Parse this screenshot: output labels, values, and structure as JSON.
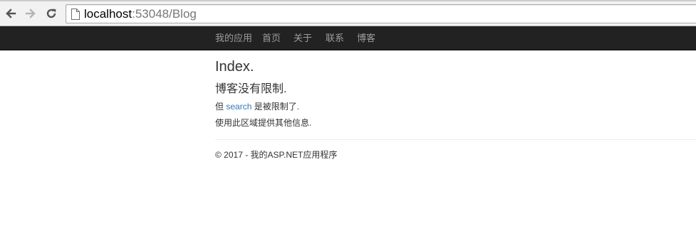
{
  "browser": {
    "url_host": "localhost",
    "url_rest": ":53048/Blog",
    "icons": {
      "back": "arrow-left-icon",
      "forward": "arrow-right-icon",
      "reload": "reload-icon",
      "page": "page-icon"
    }
  },
  "navbar": {
    "brand": "我的应用",
    "links": [
      "首页",
      "关于",
      "联系",
      "博客"
    ]
  },
  "main": {
    "title": "Index.",
    "subtitle": "博客没有限制.",
    "line1_before": "但 ",
    "line1_link": "search",
    "line1_after": " 是被限制了.",
    "line2": "使用此区域提供其他信息."
  },
  "footer": {
    "text": "© 2017 - 我的ASP.NET应用程序"
  },
  "colors": {
    "navbar_bg": "#222222",
    "navbar_text": "#9d9d9d",
    "body_text": "#333333",
    "link": "#337ab7"
  }
}
